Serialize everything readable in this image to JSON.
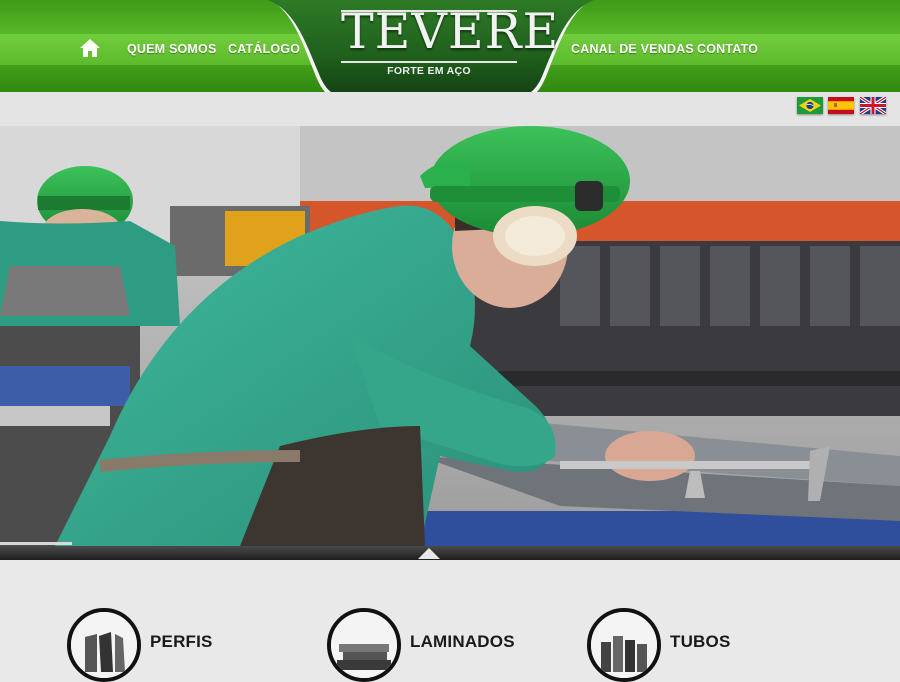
{
  "logo": {
    "name": "TEVERE",
    "tagline": "FORTE EM AÇO"
  },
  "nav": {
    "home_icon": "home-icon",
    "items": [
      {
        "label": "QUEM SOMOS"
      },
      {
        "label": "CATÁLOGO"
      },
      {
        "label": "CANAL DE VENDAS"
      },
      {
        "label": "CONTATO"
      }
    ]
  },
  "languages": [
    {
      "name": "brazil-flag-icon"
    },
    {
      "name": "spain-flag-icon"
    },
    {
      "name": "uk-flag-icon"
    }
  ],
  "hero": {
    "slide_progress": 0.08
  },
  "categories": [
    {
      "label": "PERFIS"
    },
    {
      "label": "LAMINADOS"
    },
    {
      "label": "TUBOS"
    }
  ],
  "colors": {
    "brand_green": "#4aa51c",
    "dark_green": "#1f5c1a"
  }
}
